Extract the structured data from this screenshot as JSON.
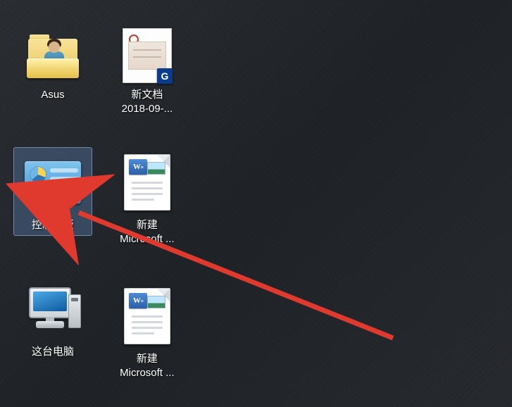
{
  "icons": {
    "asus": {
      "label": "Asus"
    },
    "scan_doc": {
      "label_line1": "新文档",
      "label_line2": "2018-09-...",
      "badge": "G"
    },
    "control_panel": {
      "label": "控制面板"
    },
    "word1": {
      "label_line1": "新建",
      "label_line2": "Microsoft ...",
      "w_glyph": "W",
      "w_eq": "≡"
    },
    "this_pc": {
      "label": "这台电脑"
    },
    "word2": {
      "label_line1": "新建",
      "label_line2": "Microsoft ...",
      "w_glyph": "W",
      "w_eq": "≡"
    }
  }
}
